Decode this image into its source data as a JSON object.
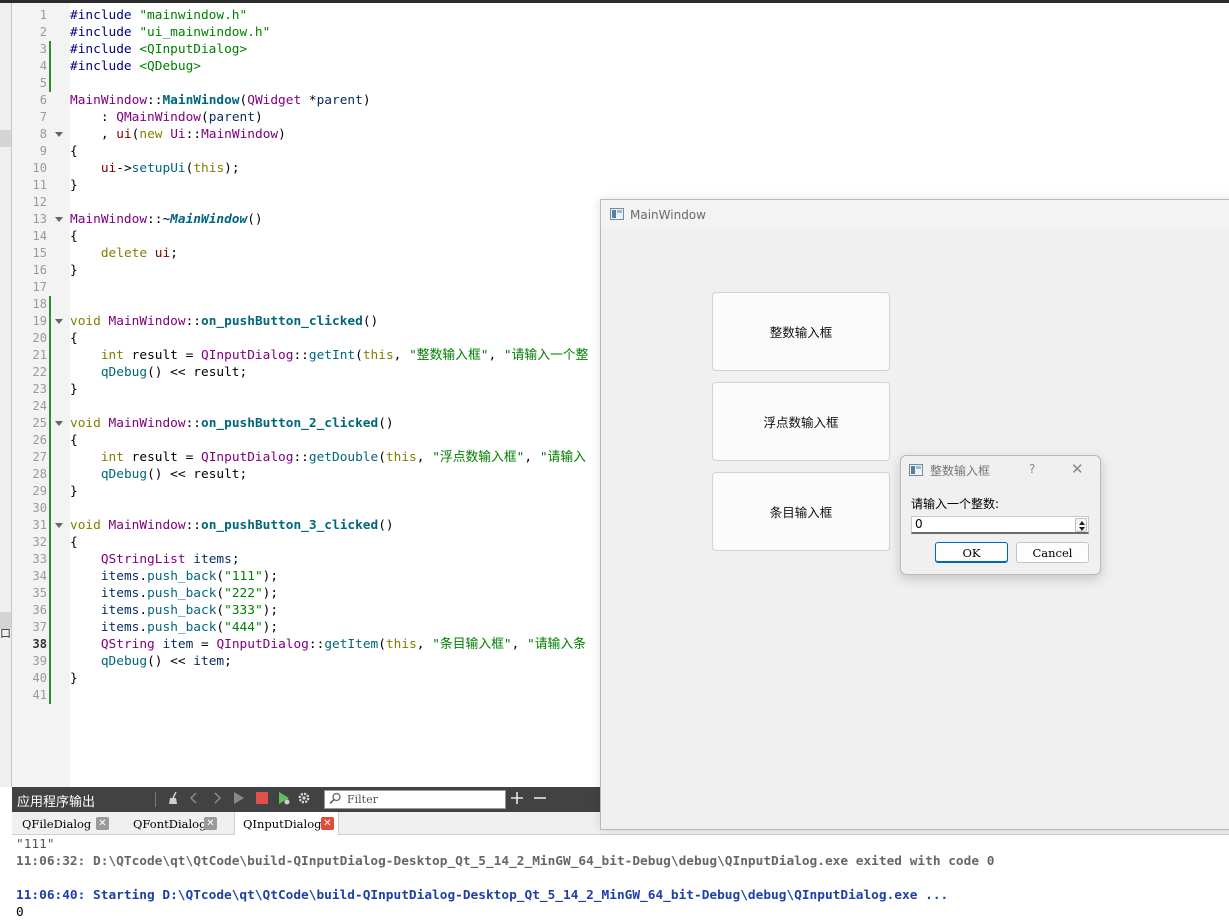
{
  "editor": {
    "line_numbers": [
      "1",
      "2",
      "3",
      "4",
      "5",
      "6",
      "7",
      "8",
      "9",
      "10",
      "11",
      "12",
      "13",
      "14",
      "15",
      "16",
      "17",
      "18",
      "19",
      "20",
      "21",
      "22",
      "23",
      "24",
      "25",
      "26",
      "27",
      "28",
      "29",
      "30",
      "31",
      "32",
      "33",
      "34",
      "35",
      "36",
      "37",
      "38",
      "39",
      "40",
      "41"
    ],
    "current_line": "38",
    "code": {
      "l1": [
        "#include ",
        "\"mainwindow.h\""
      ],
      "l2": [
        "#include ",
        "\"ui_mainwindow.h\""
      ],
      "l3": [
        "#include ",
        "<QInputDialog>"
      ],
      "l4": [
        "#include ",
        "<QDebug>"
      ],
      "l6": [
        "MainWindow",
        "::",
        "MainWindow",
        "(",
        "QWidget",
        " *",
        "parent",
        ")"
      ],
      "l7": [
        "    : ",
        "QMainWindow",
        "(",
        "parent",
        ")"
      ],
      "l8": [
        "    , ",
        "ui",
        "(",
        "new",
        " ",
        "Ui",
        "::",
        "MainWindow",
        ")"
      ],
      "l9": [
        "{"
      ],
      "l10": [
        "    ",
        "ui",
        "->",
        "setupUi",
        "(",
        "this",
        ");"
      ],
      "l11": [
        "}"
      ],
      "l13": [
        "MainWindow",
        "::~",
        "MainWindow",
        "()"
      ],
      "l14": [
        "{"
      ],
      "l15": [
        "    ",
        "delete",
        " ",
        "ui",
        ";"
      ],
      "l16": [
        "}"
      ],
      "l19": [
        "void",
        " ",
        "MainWindow",
        "::",
        "on_pushButton_clicked",
        "()"
      ],
      "l20": [
        "{"
      ],
      "l21": [
        "    ",
        "int",
        " result = ",
        "QInputDialog",
        "::",
        "getInt",
        "(",
        "this",
        ", ",
        "\"整数输入框\"",
        ", ",
        "\"请输入一个整"
      ],
      "l22": [
        "    ",
        "qDebug",
        "() << result;"
      ],
      "l23": [
        "}"
      ],
      "l25": [
        "void",
        " ",
        "MainWindow",
        "::",
        "on_pushButton_2_clicked",
        "()"
      ],
      "l26": [
        "{"
      ],
      "l27": [
        "    ",
        "int",
        " result = ",
        "QInputDialog",
        "::",
        "getDouble",
        "(",
        "this",
        ", ",
        "\"浮点数输入框\"",
        ", ",
        "\"请输入"
      ],
      "l28": [
        "    ",
        "qDebug",
        "() << result;"
      ],
      "l29": [
        "}"
      ],
      "l31": [
        "void",
        " ",
        "MainWindow",
        "::",
        "on_pushButton_3_clicked",
        "()"
      ],
      "l32": [
        "{"
      ],
      "l33": [
        "    ",
        "QStringList",
        " ",
        "items",
        ";"
      ],
      "l34": [
        "    ",
        "items",
        ".",
        "push_back",
        "(",
        "\"111\"",
        ");"
      ],
      "l35": [
        "    ",
        "items",
        ".",
        "push_back",
        "(",
        "\"222\"",
        ");"
      ],
      "l36": [
        "    ",
        "items",
        ".",
        "push_back",
        "(",
        "\"333\"",
        ");"
      ],
      "l37": [
        "    ",
        "items",
        ".",
        "push_back",
        "(",
        "\"444\"",
        ");"
      ],
      "l38": [
        "    ",
        "QString",
        " ",
        "item",
        " = ",
        "QInputDialog",
        "::",
        "getItem",
        "(",
        "this",
        ", ",
        "\"条目输入框\"",
        ", ",
        "\"请输入条"
      ],
      "l39": [
        "    ",
        "qDebug",
        "() << ",
        "item",
        ";"
      ],
      "l40": [
        "}"
      ]
    }
  },
  "left_strip": {
    "glyph": "口"
  },
  "output": {
    "title": "应用程序输出",
    "filter_placeholder": "Filter",
    "icons": {
      "clean": "broom-icon",
      "prev": "chevron-left-icon",
      "next": "chevron-right-icon",
      "run": "play-icon",
      "stop": "stop-icon",
      "debug": "debug-run-icon",
      "settings": "gear-icon",
      "add": "plus-icon",
      "remove": "minus-icon",
      "filter": "search-icon"
    },
    "tabs": [
      {
        "label": "QFileDialog"
      },
      {
        "label": "QFontDialog"
      },
      {
        "label": "QInputDialog"
      }
    ],
    "lines": [
      "\"111\"",
      "11:06:32: D:\\QTcode\\qt\\QtCode\\build-QInputDialog-Desktop_Qt_5_14_2_MinGW_64_bit-Debug\\debug\\QInputDialog.exe exited with code 0",
      "",
      "11:06:40: Starting D:\\QTcode\\qt\\QtCode\\build-QInputDialog-Desktop_Qt_5_14_2_MinGW_64_bit-Debug\\debug\\QInputDialog.exe ...",
      "0"
    ]
  },
  "main_window": {
    "title": "MainWindow",
    "buttons": [
      "整数输入框",
      "浮点数输入框",
      "条目输入框"
    ]
  },
  "dialog": {
    "title": "整数输入框",
    "help": "?",
    "close": "✕",
    "label": "请输入一个整数:",
    "value": "0",
    "ok": "OK",
    "cancel": "Cancel"
  },
  "colors": {
    "keyword": "#808000",
    "string": "#008000",
    "type": "#800080",
    "function": "#00677c",
    "preprocessor": "#000080",
    "output_start": "#1f3fa8",
    "accent": "#0067c0"
  }
}
